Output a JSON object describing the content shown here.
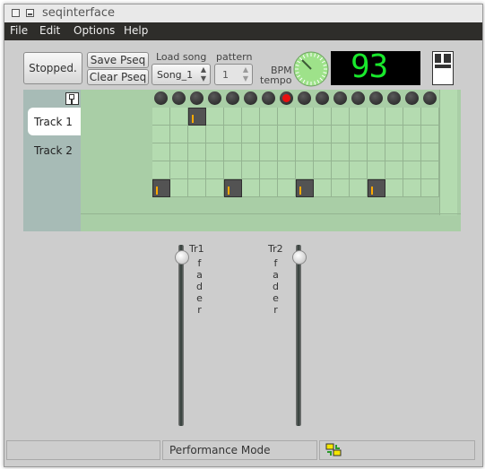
{
  "window": {
    "title": "seqinterface"
  },
  "menu": [
    "File",
    "Edit",
    "Options",
    "Help"
  ],
  "toolbar": {
    "play_state": "Stopped.",
    "save_label": "Save Pseq",
    "clear_label": "Clear Pseq",
    "load_song_label": "Load song",
    "song_value": "Song_1",
    "pattern_label": "pattern",
    "pattern_value": "1",
    "bpm_label": "BPM",
    "tempo_label": "tempo",
    "bpm_display": "93",
    "colors": {
      "dial": "#9ee28a",
      "display_bg": "#000000",
      "display_fg": "#19e82c"
    }
  },
  "tracks": [
    {
      "label": "Track 1",
      "selected": true
    },
    {
      "label": "Track 2",
      "selected": false
    }
  ],
  "sequencer": {
    "steps": 16,
    "rows": 5,
    "active_step": 7,
    "notes": [
      {
        "row": 0,
        "step": 2
      },
      {
        "row": 4,
        "step": 0
      },
      {
        "row": 4,
        "step": 4
      },
      {
        "row": 4,
        "step": 8
      },
      {
        "row": 4,
        "step": 12
      }
    ],
    "colors": {
      "cell": "#b4dbb0",
      "note": "#535353",
      "note_marker": "#ffaa00",
      "active_led": "#e81010"
    }
  },
  "faders": [
    {
      "label": "Tr1",
      "sub": [
        "f",
        "a",
        "d",
        "e",
        "r"
      ]
    },
    {
      "label": "Tr2",
      "sub": [
        "f",
        "a",
        "d",
        "e",
        "r"
      ]
    }
  ],
  "status": {
    "mode": "Performance Mode"
  }
}
